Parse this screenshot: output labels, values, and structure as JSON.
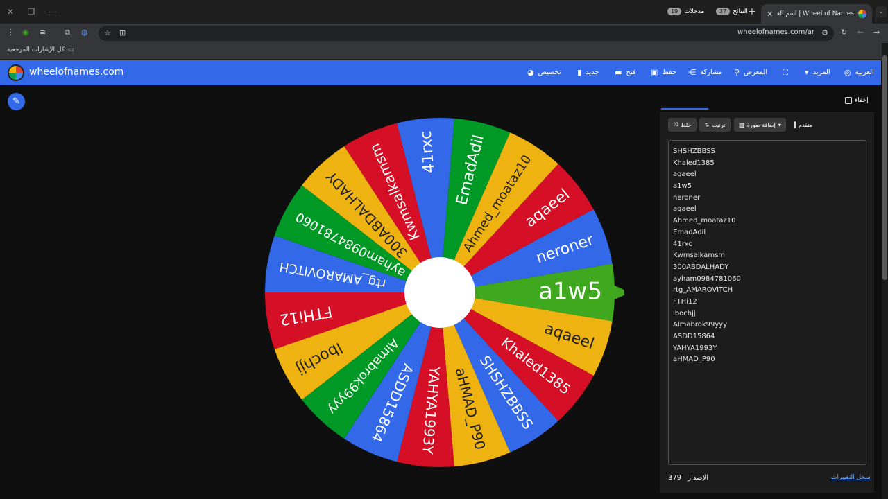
{
  "browser": {
    "tab_title": "Wheel of Names | اسم العشوائي",
    "url": "wheelofnames.com/ar",
    "bookmarks_label": "كل الإشارات المرجعية"
  },
  "header": {
    "brand": "wheelofnames.com",
    "nav": {
      "customize": "تخصيص",
      "new": "جديد",
      "open": "فتح",
      "save": "حفظ",
      "share": "مشاركة",
      "gallery": "المعرض",
      "more": "المزيد",
      "language": "العربية"
    }
  },
  "panel": {
    "hide_label": "إخفاء",
    "tab_entries": "مدخلات",
    "tab_entries_count": "19",
    "tab_results": "النتائج",
    "tab_results_count": "37",
    "shuffle": "خلط",
    "sort": "ترتيب",
    "add_image": "إضافة صورة",
    "advanced": "متقدم",
    "entries": [
      "SHSHZBBSS",
      "Khaled1385",
      "aqaeel",
      "a1w5",
      "neroner",
      "aqaeel",
      "Ahmed_moataz10",
      "EmadAdil",
      "41rxc",
      "Kwmsalkamsm",
      "300ABDALHADY",
      "ayham0984781060",
      "rtg_AMAROVITCH",
      "FTHi12",
      "lbochjj",
      "Almabrok99yyy",
      "ASDD15864",
      "YAHYA1993Y",
      "aHMAD_P90"
    ],
    "version_label": "الإصدار",
    "version_number": "379",
    "changelog": "سجل التغييرات"
  },
  "wheel": {
    "segments": [
      {
        "label": "a1w5",
        "color": "#3fa81f"
      },
      {
        "label": "aqaeel",
        "color": "#eeb211"
      },
      {
        "label": "Khaled1385",
        "color": "#d50f25"
      },
      {
        "label": "SHSHZBBSS",
        "color": "#3369e8"
      },
      {
        "label": "aHMAD_P90",
        "color": "#eeb211"
      },
      {
        "label": "YAHYA1993Y",
        "color": "#d50f25"
      },
      {
        "label": "ASDD15864",
        "color": "#3369e8"
      },
      {
        "label": "Almabrok99yyy",
        "color": "#009925"
      },
      {
        "label": "lbochjj",
        "color": "#eeb211"
      },
      {
        "label": "FTHi12",
        "color": "#d50f25"
      },
      {
        "label": "rtg_AMAROVITCH",
        "color": "#3369e8"
      },
      {
        "label": "ayham0984781060",
        "color": "#009925"
      },
      {
        "label": "300ABDALHADY",
        "color": "#eeb211"
      },
      {
        "label": "Kwmsalkamsm",
        "color": "#d50f25"
      },
      {
        "label": "41rxc",
        "color": "#3369e8"
      },
      {
        "label": "EmadAdil",
        "color": "#009925"
      },
      {
        "label": "Ahmed_moataz10",
        "color": "#eeb211"
      },
      {
        "label": "aqaeel",
        "color": "#d50f25"
      },
      {
        "label": "neroner",
        "color": "#3369e8"
      }
    ],
    "selected": "a1w5"
  }
}
